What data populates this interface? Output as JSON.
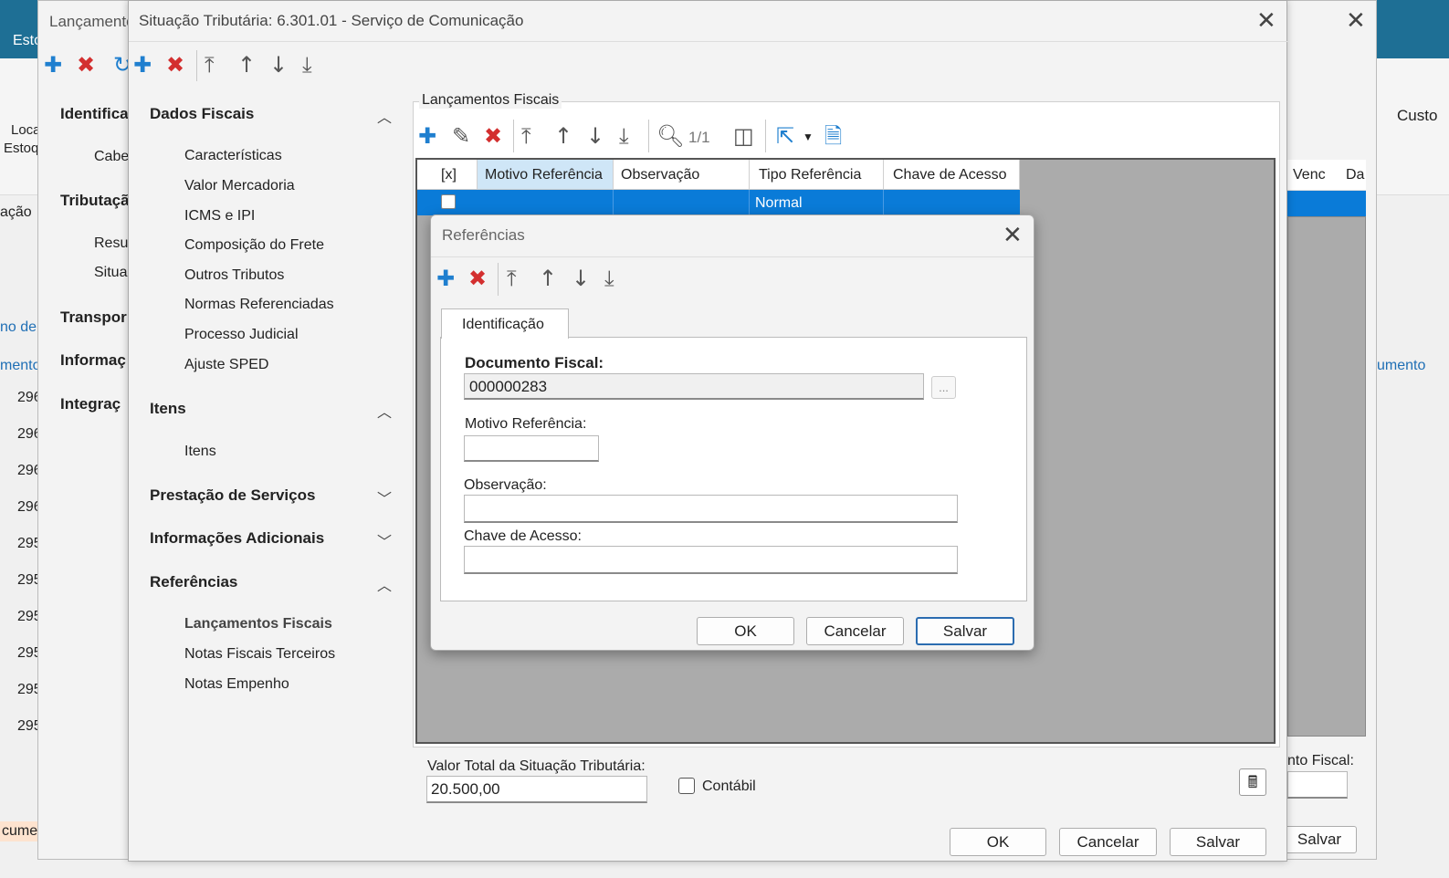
{
  "bg": {
    "tab_esto": "Esto",
    "loca": "Loca",
    "estoq": "Estoq",
    "custo": "Custo",
    "col_venc": "Venc",
    "col_da": "Da",
    "umento": "umento",
    "cao": "ação",
    "no_de": "no de",
    "mento": "mento",
    "rows": [
      "296",
      "296",
      "296",
      "296",
      "295",
      "295",
      "295",
      "295",
      "295",
      "295"
    ],
    "fiscal_label": "nto Fiscal:",
    "cumer": "cumer",
    "salvar": "Salvar"
  },
  "win1": {
    "title": "Lançamento",
    "left_nav": [
      "Identifica",
      "Cabe",
      "Tributaçã",
      "Resu",
      "Situa",
      "Transpor",
      "Informaç",
      "Integraç"
    ]
  },
  "win2": {
    "title": "Situação Tributária: 6.301.01 - Serviço de Comunicação",
    "sections": [
      {
        "title": "Dados Fiscais",
        "items": [
          "Características",
          "Valor Mercadoria",
          "ICMS e IPI",
          "Composição do Frete",
          "Outros Tributos",
          "Normas Referenciadas",
          "Processo Judicial",
          "Ajuste SPED"
        ]
      },
      {
        "title": "Itens",
        "items": [
          "Itens"
        ]
      },
      {
        "title": "Prestação de Serviços",
        "items": []
      },
      {
        "title": "Informações Adicionais",
        "items": []
      },
      {
        "title": "Referências",
        "items": [
          "Lançamentos Fiscais",
          "Notas Fiscais Terceiros",
          "Notas Empenho"
        ]
      }
    ],
    "group_title": "Lançamentos Fiscais",
    "pager": "1/1",
    "columns": [
      "[x]",
      "Motivo Referência",
      "Observação",
      "Tipo Referência",
      "Chave de Acesso"
    ],
    "row": {
      "motivo": "",
      "observacao": "",
      "tipo": "Normal",
      "chave": ""
    },
    "valor_label": "Valor Total da Situação Tributária:",
    "valor": "20.500,00",
    "contabil": "Contábil",
    "ok": "OK",
    "cancelar": "Cancelar",
    "salvar": "Salvar"
  },
  "dialog": {
    "title": "Referências",
    "tab": "Identificação",
    "doc_label": "Documento Fiscal:",
    "doc_value": "000000283",
    "ellipsis": "...",
    "motivo_label": "Motivo Referência:",
    "obs_label": "Observação:",
    "chave_label": "Chave de Acesso:",
    "ok": "OK",
    "cancelar": "Cancelar",
    "salvar": "Salvar"
  }
}
